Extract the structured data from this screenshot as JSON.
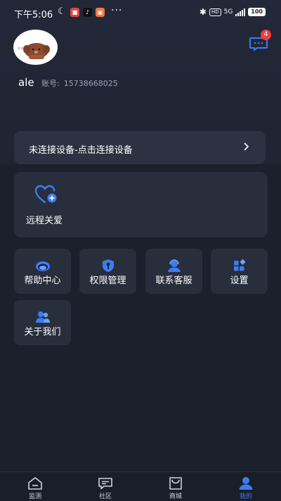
{
  "status_bar": {
    "time": "下午5:06",
    "network": "5G",
    "hd": "HD",
    "battery": "100",
    "dots": "···"
  },
  "profile": {
    "username": "ale",
    "account_label": "账号:",
    "account_number": "15738668025"
  },
  "messages": {
    "badge_count": "4"
  },
  "device": {
    "label": "未连接设备-点击连接设备"
  },
  "care": {
    "label": "远程关爱"
  },
  "tiles": [
    {
      "label": "帮助中心",
      "icon": "headset-icon"
    },
    {
      "label": "权限管理",
      "icon": "shield-key-icon"
    },
    {
      "label": "联系客服",
      "icon": "customer-service-icon"
    },
    {
      "label": "设置",
      "icon": "settings-grid-icon"
    },
    {
      "label": "关于我们",
      "icon": "people-icon"
    }
  ],
  "bottom_nav": [
    {
      "label": "监测",
      "icon": "home-icon",
      "active": false
    },
    {
      "label": "社区",
      "icon": "chat-icon",
      "active": false
    },
    {
      "label": "商城",
      "icon": "shop-icon",
      "active": false
    },
    {
      "label": "我的",
      "icon": "person-icon",
      "active": true
    }
  ],
  "colors": {
    "accent": "#3d7cf5",
    "badge": "#ef3d3d",
    "card": "#282e3c",
    "background": "#1e2331"
  }
}
